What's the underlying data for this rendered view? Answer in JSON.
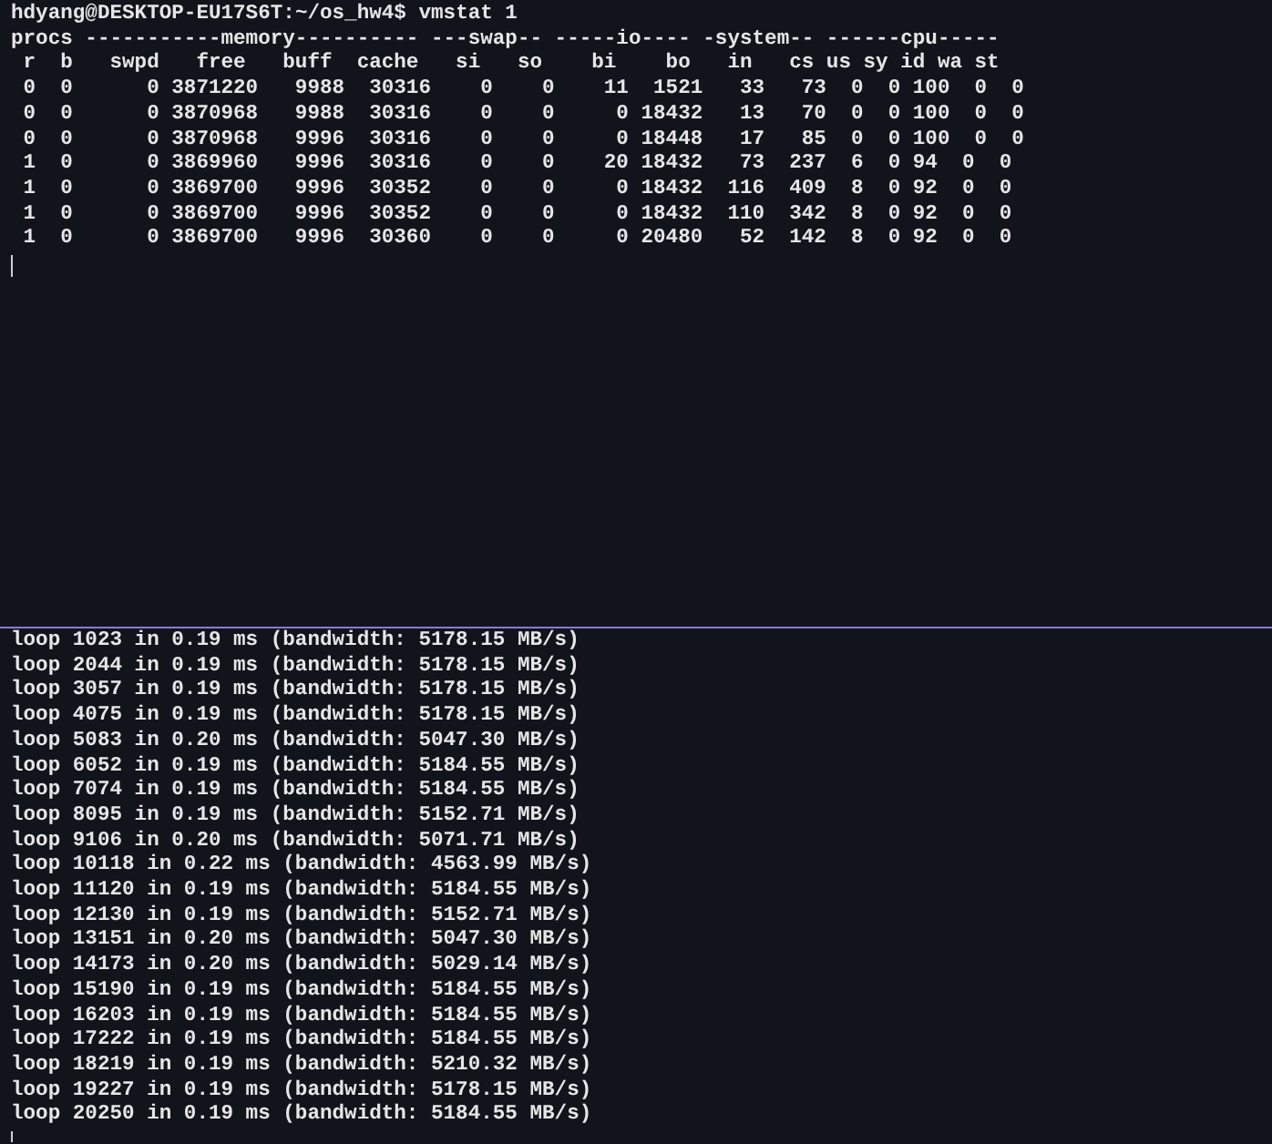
{
  "top_pane": {
    "prompt": {
      "user_host": "hdyang@DESKTOP-EU17S6T",
      "separator": ":",
      "path": "~/os_hw4",
      "command": "$ vmstat 1"
    },
    "lines": [
      "procs -----------memory---------- ---swap-- -----io---- -system-- ------cpu-----",
      " r  b   swpd   free   buff  cache   si   so    bi    bo   in   cs us sy id wa st",
      " 0  0      0 3871220   9988  30316    0    0    11  1521   33   73  0  0 100  0  0",
      " 0  0      0 3870968   9988  30316    0    0     0 18432   13   70  0  0 100  0  0",
      " 0  0      0 3870968   9996  30316    0    0     0 18448   17   85  0  0 100  0  0",
      " 1  0      0 3869960   9996  30316    0    0    20 18432   73  237  6  0 94  0  0",
      " 1  0      0 3869700   9996  30352    0    0     0 18432  116  409  8  0 92  0  0",
      " 1  0      0 3869700   9996  30352    0    0     0 18432  110  342  8  0 92  0  0",
      " 1  0      0 3869700   9996  30360    0    0     0 20480   52  142  8  0 92  0  0"
    ]
  },
  "bottom_pane": {
    "lines": [
      "loop 1023 in 0.19 ms (bandwidth: 5178.15 MB/s)",
      "loop 2044 in 0.19 ms (bandwidth: 5178.15 MB/s)",
      "loop 3057 in 0.19 ms (bandwidth: 5178.15 MB/s)",
      "loop 4075 in 0.19 ms (bandwidth: 5178.15 MB/s)",
      "loop 5083 in 0.20 ms (bandwidth: 5047.30 MB/s)",
      "loop 6052 in 0.19 ms (bandwidth: 5184.55 MB/s)",
      "loop 7074 in 0.19 ms (bandwidth: 5184.55 MB/s)",
      "loop 8095 in 0.19 ms (bandwidth: 5152.71 MB/s)",
      "loop 9106 in 0.20 ms (bandwidth: 5071.71 MB/s)",
      "loop 10118 in 0.22 ms (bandwidth: 4563.99 MB/s)",
      "loop 11120 in 0.19 ms (bandwidth: 5184.55 MB/s)",
      "loop 12130 in 0.19 ms (bandwidth: 5152.71 MB/s)",
      "loop 13151 in 0.20 ms (bandwidth: 5047.30 MB/s)",
      "loop 14173 in 0.20 ms (bandwidth: 5029.14 MB/s)",
      "loop 15190 in 0.19 ms (bandwidth: 5184.55 MB/s)",
      "loop 16203 in 0.19 ms (bandwidth: 5184.55 MB/s)",
      "loop 17222 in 0.19 ms (bandwidth: 5184.55 MB/s)",
      "loop 18219 in 0.19 ms (bandwidth: 5210.32 MB/s)",
      "loop 19227 in 0.19 ms (bandwidth: 5178.15 MB/s)",
      "loop 20250 in 0.19 ms (bandwidth: 5184.55 MB/s)"
    ]
  }
}
